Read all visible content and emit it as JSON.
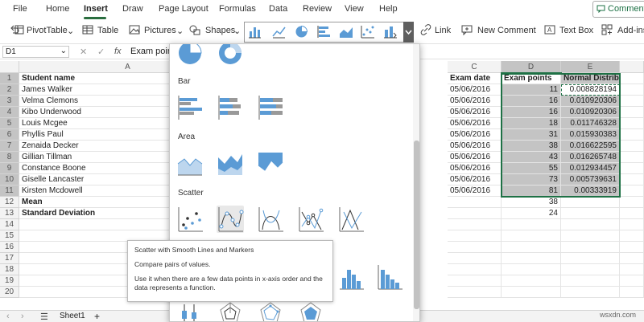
{
  "menu": {
    "items": [
      "File",
      "Home",
      "Insert",
      "Draw",
      "Page Layout",
      "Formulas",
      "Data",
      "Review",
      "View",
      "Help"
    ],
    "active": "Insert",
    "comments": "Comments"
  },
  "toolbar": {
    "pivot": "PivotTable",
    "table": "Table",
    "pictures": "Pictures",
    "shapes": "Shapes",
    "link": "Link",
    "new_comment": "New Comment",
    "textbox": "Text Box",
    "addins": "Add-ins"
  },
  "formula": {
    "namebox": "D1",
    "fx": "fx",
    "value": "Exam points"
  },
  "columns": [
    "A",
    "C",
    "D",
    "E"
  ],
  "rows": [
    "1",
    "2",
    "3",
    "4",
    "5",
    "6",
    "7",
    "8",
    "9",
    "10",
    "11",
    "12",
    "13",
    "14",
    "15",
    "16",
    "17",
    "18",
    "19",
    "20"
  ],
  "sheet": {
    "headers": {
      "name": "Student name",
      "date": "Exam date",
      "points": "Exam points",
      "dist": "Normal Distribution"
    },
    "students": [
      {
        "name": "James Walker",
        "date": "05/06/2016",
        "points": "11",
        "dist": "0.008828194"
      },
      {
        "name": "Velma Clemons",
        "date": "05/06/2016",
        "points": "16",
        "dist": "0.010920306"
      },
      {
        "name": "Kibo Underwood",
        "date": "05/06/2016",
        "points": "16",
        "dist": "0.010920306"
      },
      {
        "name": "Louis Mcgee",
        "date": "05/06/2016",
        "points": "18",
        "dist": "0.011746328"
      },
      {
        "name": "Phyllis Paul",
        "date": "05/06/2016",
        "points": "31",
        "dist": "0.015930383"
      },
      {
        "name": "Zenaida Decker",
        "date": "05/06/2016",
        "points": "38",
        "dist": "0.016622595"
      },
      {
        "name": "Gillian Tillman",
        "date": "05/06/2016",
        "points": "43",
        "dist": "0.016265748"
      },
      {
        "name": "Constance Boone",
        "date": "05/06/2016",
        "points": "55",
        "dist": "0.012934457"
      },
      {
        "name": "Giselle Lancaster",
        "date": "05/06/2016",
        "points": "73",
        "dist": "0.005739631"
      },
      {
        "name": "Kirsten Mcdowell",
        "date": "05/06/2016",
        "points": "81",
        "dist": "0.00333919"
      }
    ],
    "mean_label": "Mean",
    "mean_value": "38",
    "sd_label": "Standard Deviation",
    "sd_value": "24"
  },
  "gallery": {
    "sections": [
      "Bar",
      "Area",
      "Scatter"
    ]
  },
  "tooltip": {
    "title": "Scatter with Smooth Lines and Markers",
    "line1": "Compare pairs of values.",
    "line2": "Use it when there are a few data points in x-axis order and the data represents a function."
  },
  "sheettab": {
    "name": "Sheet1",
    "add": "+"
  },
  "watermark": "wsxdn.com",
  "colors": {
    "accent": "#1e7145",
    "chart_blue": "#5b9bd5",
    "selection": "#c4c4c4"
  }
}
